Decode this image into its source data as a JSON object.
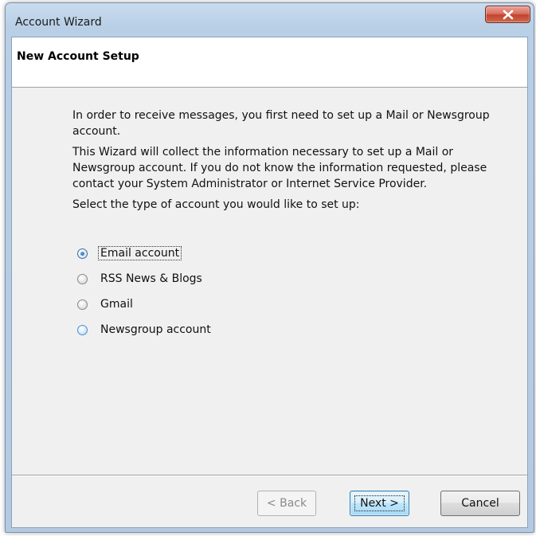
{
  "window": {
    "title": "Account Wizard",
    "close_icon": "close-x-icon"
  },
  "header": {
    "title": "New Account Setup"
  },
  "body": {
    "paragraph1": "In order to receive messages, you first need to set up a Mail or Newsgroup account.",
    "paragraph2": "This Wizard will collect the information necessary to set up a Mail or Newsgroup account. If you do not know the information requested, please contact your System Administrator or Internet Service Provider.",
    "paragraph3": "Select the type of account you would like to set up:"
  },
  "account_types": {
    "selected": "Email account",
    "options": [
      {
        "label": "Email account",
        "checked": true
      },
      {
        "label": "RSS News & Blogs",
        "checked": false
      },
      {
        "label": "Gmail",
        "checked": false
      },
      {
        "label": "Newsgroup account",
        "checked": false
      }
    ]
  },
  "buttons": {
    "back": "< Back",
    "next": "Next >",
    "cancel": "Cancel"
  },
  "colors": {
    "frame": "#b9cfe6",
    "close_button": "#c2432e",
    "default_button": "#bee6fd"
  }
}
